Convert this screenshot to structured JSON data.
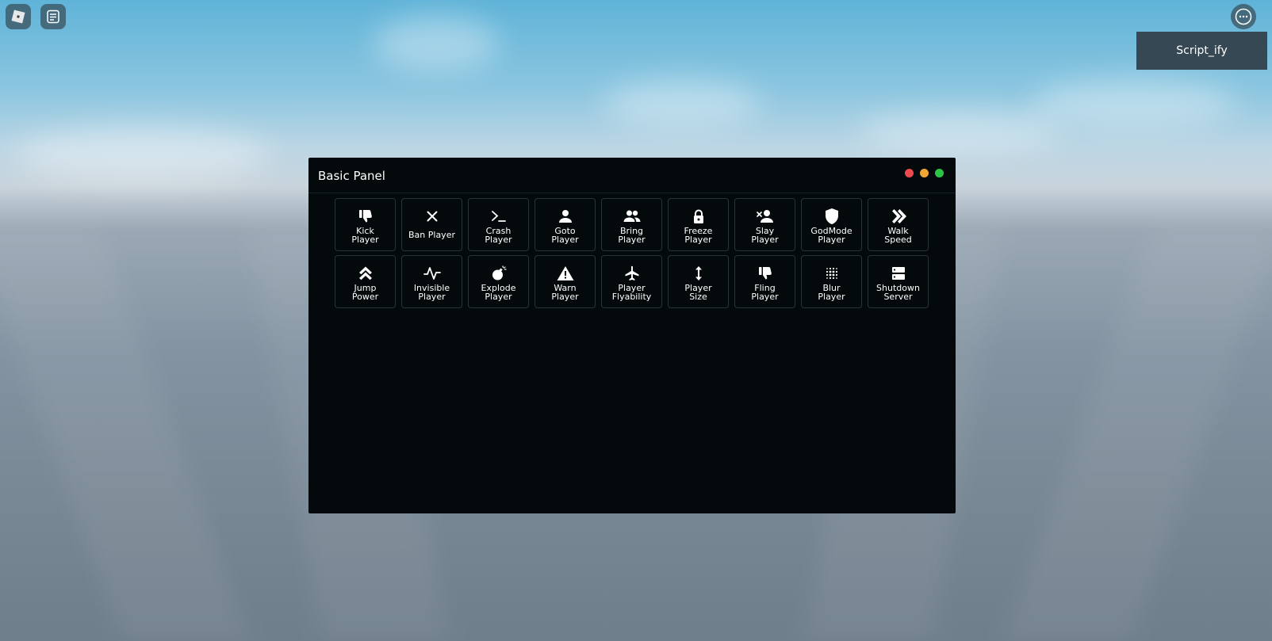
{
  "topbar": {
    "roblox_icon": "roblox-logo-icon",
    "chat_icon": "chat-icon",
    "menu_icon": "more-menu-icon"
  },
  "notification": {
    "text": "Script_ify"
  },
  "panel": {
    "title": "Basic Panel",
    "window_controls": [
      "close",
      "minimize",
      "maximize"
    ],
    "colors": {
      "close": "#ec4a4e",
      "minimize": "#f0a534",
      "maximize": "#2cc444",
      "panel_bg": "#040a0c",
      "notification_bg": "#364853"
    },
    "buttons": [
      {
        "label": "Kick\nPlayer",
        "icon": "thumbs-down-icon"
      },
      {
        "label": "Ban Player",
        "icon": "close-icon"
      },
      {
        "label": "Crash\nPlayer",
        "icon": "terminal-icon"
      },
      {
        "label": "Goto\nPlayer",
        "icon": "person-icon"
      },
      {
        "label": "Bring\nPlayer",
        "icon": "people-icon"
      },
      {
        "label": "Freeze\nPlayer",
        "icon": "lock-icon"
      },
      {
        "label": "Slay\nPlayer",
        "icon": "remove-person-icon"
      },
      {
        "label": "GodMode\nPlayer",
        "icon": "shield-icon"
      },
      {
        "label": "Walk\nSpeed",
        "icon": "double-chevron-right-icon"
      },
      {
        "label": "Jump\nPower",
        "icon": "double-chevron-up-icon"
      },
      {
        "label": "Invisible\nPlayer",
        "icon": "pulse-icon"
      },
      {
        "label": "Explode\nPlayer",
        "icon": "bomb-icon"
      },
      {
        "label": "Warn\nPlayer",
        "icon": "warning-icon"
      },
      {
        "label": "Player\nFlyability",
        "icon": "airplane-icon"
      },
      {
        "label": "Player\nSize",
        "icon": "vertical-resize-icon"
      },
      {
        "label": "Fling\nPlayer",
        "icon": "thumbs-down-icon"
      },
      {
        "label": "Blur\nPlayer",
        "icon": "blur-grid-icon"
      },
      {
        "label": "Shutdown\nServer",
        "icon": "server-icon"
      }
    ]
  }
}
